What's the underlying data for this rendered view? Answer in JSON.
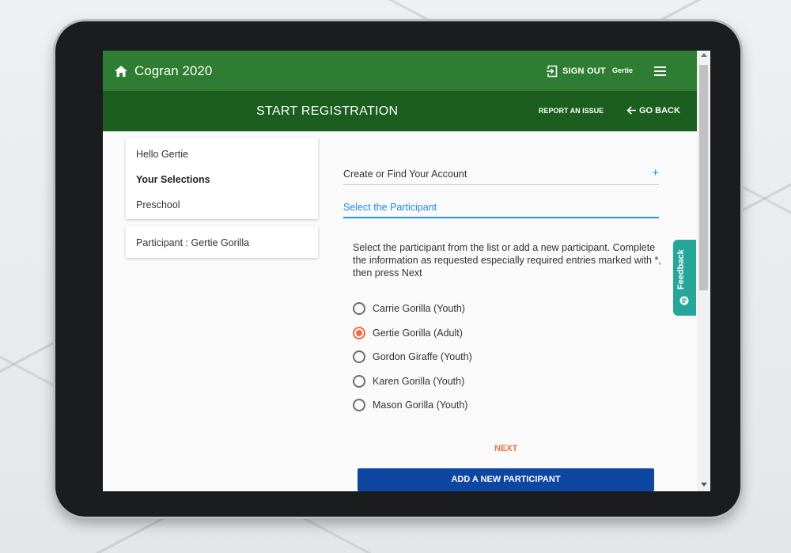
{
  "header": {
    "app_title": "Cogran 2020",
    "sign_out_label": "SIGN OUT",
    "user_name": "Gertie"
  },
  "subheader": {
    "title": "START REGISTRATION",
    "report_issue_label": "REPORT AN ISSUE",
    "go_back_label": "GO BACK"
  },
  "sidebar": {
    "greeting": "Hello Gertie",
    "selections_heading": "Your Selections",
    "selection_item": "Preschool",
    "participant_line": "Participant : Gertie Gorilla"
  },
  "steps": {
    "account_label": "Create or Find Your Account",
    "participant_label": "Select the Participant"
  },
  "instructions": "Select the participant from the list or add a new participant. Complete the information as requested especially required entries marked with *, then press Next",
  "participants": [
    {
      "label": "Carrie Gorilla (Youth)",
      "selected": false
    },
    {
      "label": "Gertie Gorilla (Adult)",
      "selected": true
    },
    {
      "label": "Gordon Giraffe (Youth)",
      "selected": false
    },
    {
      "label": "Karen Gorilla (Youth)",
      "selected": false
    },
    {
      "label": "Mason Gorilla (Youth)",
      "selected": false
    }
  ],
  "actions": {
    "next_label": "NEXT",
    "add_participant_label": "ADD A NEW PARTICIPANT"
  },
  "feedback": {
    "label": "Feedback"
  },
  "colors": {
    "appbar": "#2e7d32",
    "subbar": "#1b5e20",
    "accent_orange": "#ef6c45",
    "primary_blue": "#0d47a1",
    "feedback_teal": "#26a69a",
    "step_blue": "#1e88e5"
  }
}
